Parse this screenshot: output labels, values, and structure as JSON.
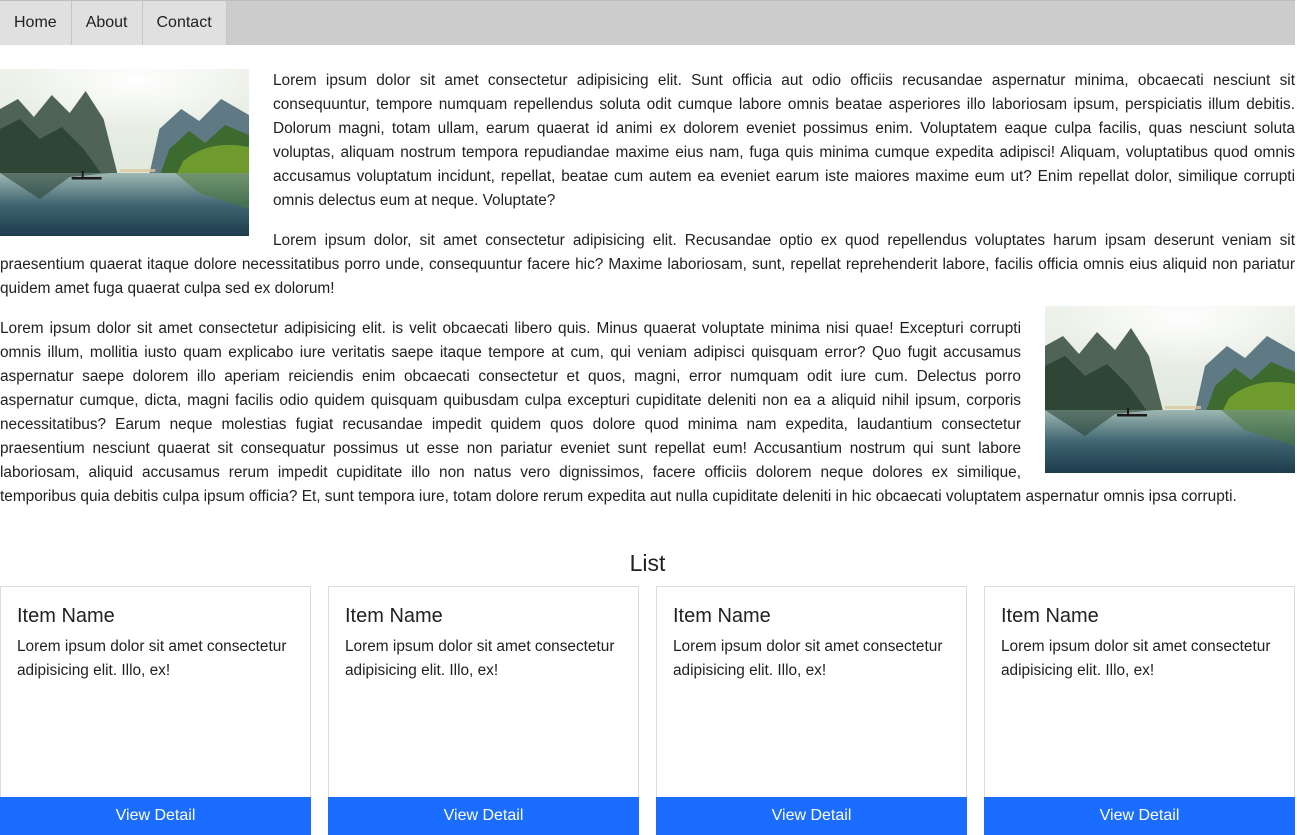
{
  "nav": {
    "items": [
      {
        "label": "Home"
      },
      {
        "label": "About"
      },
      {
        "label": "Contact"
      }
    ]
  },
  "content": {
    "paragraphs": [
      "Lorem ipsum dolor sit amet consectetur adipisicing elit. Sunt officia aut odio officiis recusandae aspernatur minima, obcaecati nesciunt sit consequuntur, tempore numquam repellendus soluta odit cumque labore omnis beatae asperiores illo laboriosam ipsum, perspiciatis illum debitis. Dolorum magni, totam ullam, earum quaerat id animi ex dolorem eveniet possimus enim. Voluptatem eaque culpa facilis, quas nesciunt soluta voluptas, aliquam nostrum tempora repudiandae maxime eius nam, fuga quis minima cumque expedita adipisci! Aliquam, voluptatibus quod omnis accusamus voluptatum incidunt, repellat, beatae cum autem ea eveniet earum iste maiores maxime eum ut? Enim repellat dolor, similique corrupti omnis delectus eum at neque. Voluptate?",
      "Lorem ipsum dolor, sit amet consectetur adipisicing elit. Recusandae optio ex quod repellendus voluptates harum ipsam deserunt veniam sit praesentium quaerat itaque dolore necessitatibus porro unde, consequuntur facere hic? Maxime laboriosam, sunt, repellat reprehenderit labore, facilis officia omnis eius aliquid non pariatur quidem amet fuga quaerat culpa sed ex dolorum!",
      "Lorem ipsum dolor sit amet consectetur adipisicing elit. is velit obcaecati libero quis. Minus quaerat voluptate minima nisi quae! Excepturi corrupti omnis illum, mollitia iusto quam explicabo iure veritatis saepe itaque tempore at cum, qui veniam adipisci quisquam error? Quo fugit accusamus aspernatur saepe dolorem illo aperiam reiciendis enim obcaecati consectetur et quos, magni, error numquam odit iure cum. Delectus porro aspernatur cumque, dicta, magni facilis odio quidem quisquam quibusdam culpa excepturi cupiditate deleniti non ea a aliquid nihil ipsum, corporis necessitatibus? Earum neque molestias fugiat recusandae impedit quidem quos dolore quod minima nam expedita, laudantium consectetur praesentium nesciunt quaerat sit consequatur possimus ut esse non pariatur eveniet sunt repellat eum! Accusantium nostrum qui sunt labore laboriosam, aliquid accusamus rerum impedit cupiditate illo non natus vero dignissimos, facere officiis dolorem neque dolores ex similique, temporibus quia debitis culpa ipsum officia? Et, sunt tempora iure, totam dolore rerum expedita aut nulla cupiditate deleniti in hic obcaecati voluptatem aspernatur omnis ipsa corrupti."
    ]
  },
  "list": {
    "title": "List",
    "cards": [
      {
        "name": "Item Name",
        "description": "Lorem ipsum dolor sit amet consectetur adipisicing elit. Illo, ex!",
        "button": "View Detail"
      },
      {
        "name": "Item Name",
        "description": "Lorem ipsum dolor sit amet consectetur adipisicing elit. Illo, ex!",
        "button": "View Detail"
      },
      {
        "name": "Item Name",
        "description": "Lorem ipsum dolor sit amet consectetur adipisicing elit. Illo, ex!",
        "button": "View Detail"
      },
      {
        "name": "Item Name",
        "description": "Lorem ipsum dolor sit amet consectetur adipisicing elit. Illo, ex!",
        "button": "View Detail"
      }
    ]
  },
  "colors": {
    "nav_bar": "#cccccc",
    "nav_item": "#e0e0e0",
    "button": "#1a6dff",
    "button_text": "#ffffff",
    "text": "#212121"
  }
}
